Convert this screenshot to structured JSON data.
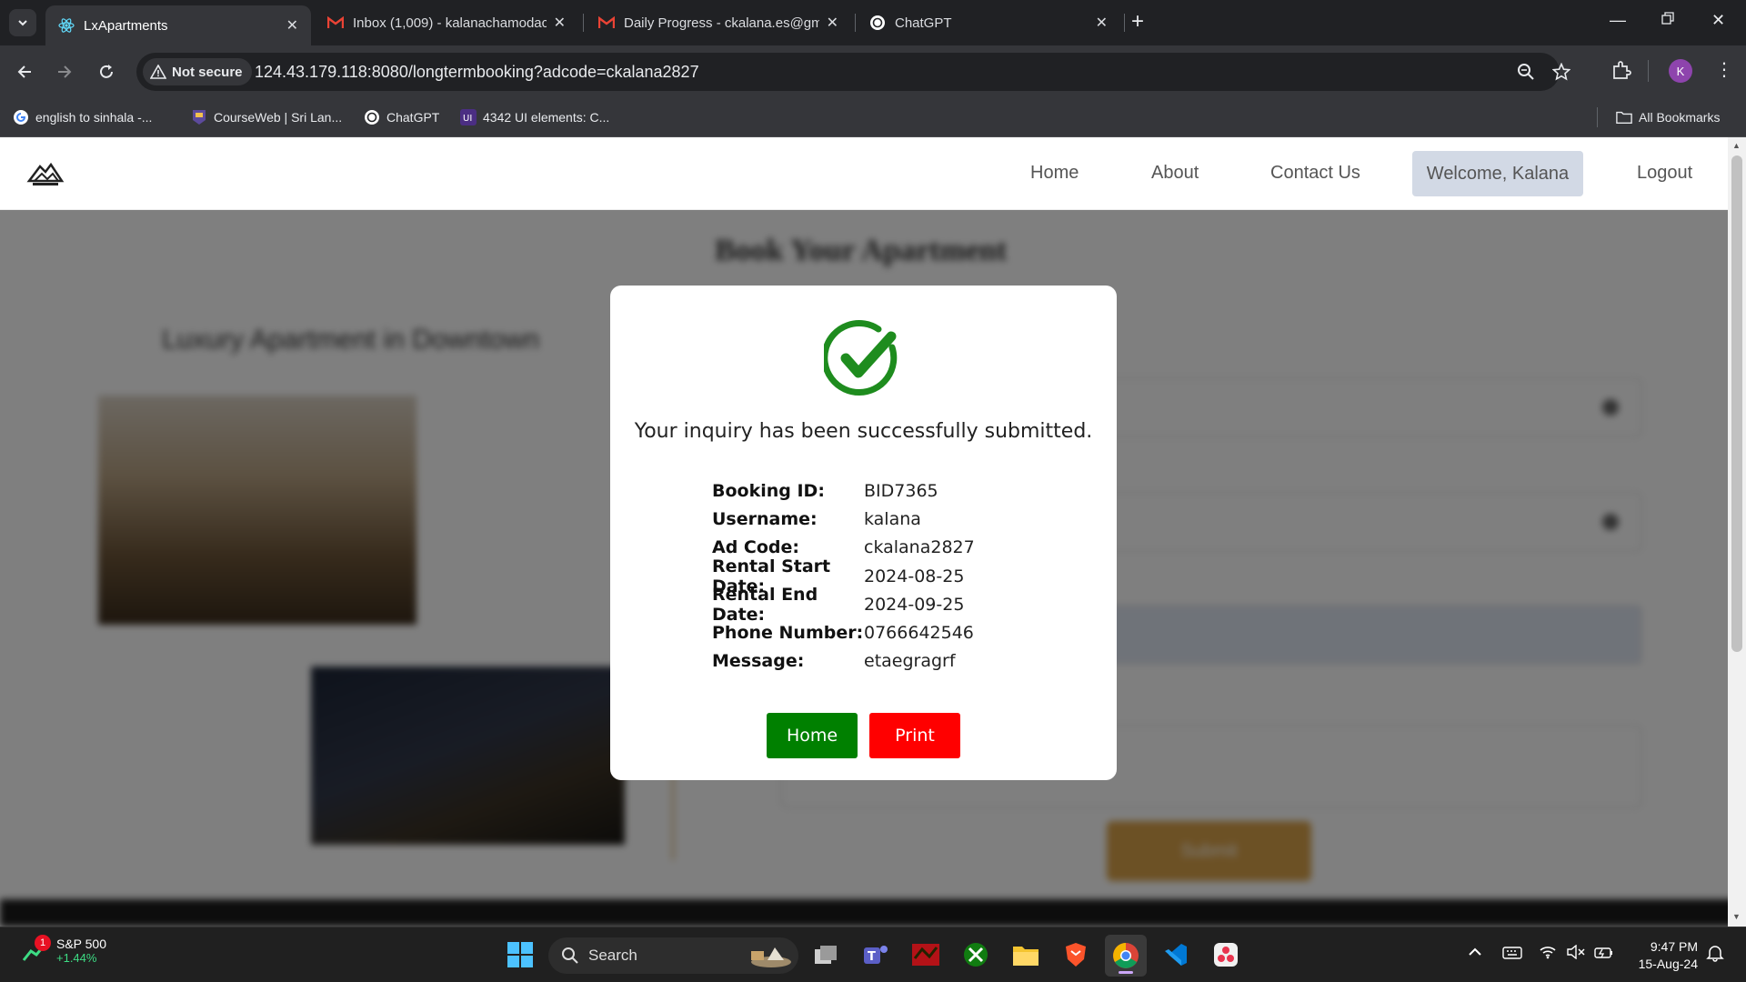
{
  "browser": {
    "tabs": [
      {
        "title": "LxApartments",
        "active": true
      },
      {
        "title": "Inbox (1,009) - kalanachamodac",
        "active": false
      },
      {
        "title": "Daily Progress - ckalana.es@gm",
        "active": false
      },
      {
        "title": "ChatGPT",
        "active": false
      }
    ],
    "security_chip": "Not secure",
    "url": "124.43.179.118:8080/longtermbooking?adcode=ckalana2827",
    "profile_initial": "K",
    "bookmarks": [
      {
        "label": "english to sinhala -..."
      },
      {
        "label": "CourseWeb | Sri Lan..."
      },
      {
        "label": "ChatGPT"
      },
      {
        "label": "4342 UI elements: C..."
      }
    ],
    "all_bookmarks": "All Bookmarks"
  },
  "site": {
    "nav": {
      "home": "Home",
      "about": "About",
      "contact": "Contact Us",
      "welcome": "Welcome, Kalana",
      "logout": "Logout"
    },
    "page_title": "Book Your Apartment",
    "listing_title": "Luxury Apartment in Downtown",
    "submit_label": "Submit"
  },
  "modal": {
    "message": "Your inquiry has been successfully submitted.",
    "details": [
      {
        "label": "Booking ID:",
        "value": "BID7365"
      },
      {
        "label": "Username:",
        "value": "kalana"
      },
      {
        "label": "Ad Code:",
        "value": "ckalana2827"
      },
      {
        "label": "Rental Start Date:",
        "value": "2024-08-25"
      },
      {
        "label": "Rental End Date:",
        "value": "2024-09-25"
      },
      {
        "label": "Phone Number:",
        "value": "0766642546"
      },
      {
        "label": "Message:",
        "value": "etaegragrf"
      }
    ],
    "home_button": "Home",
    "print_button": "Print",
    "colors": {
      "success": "#008000",
      "danger": "#ff0000"
    }
  },
  "taskbar": {
    "widget_badge": "1",
    "widget_title": "S&P 500",
    "widget_change": "+1.44%",
    "search_label": "Search",
    "time": "9:47 PM",
    "date": "15-Aug-24"
  }
}
